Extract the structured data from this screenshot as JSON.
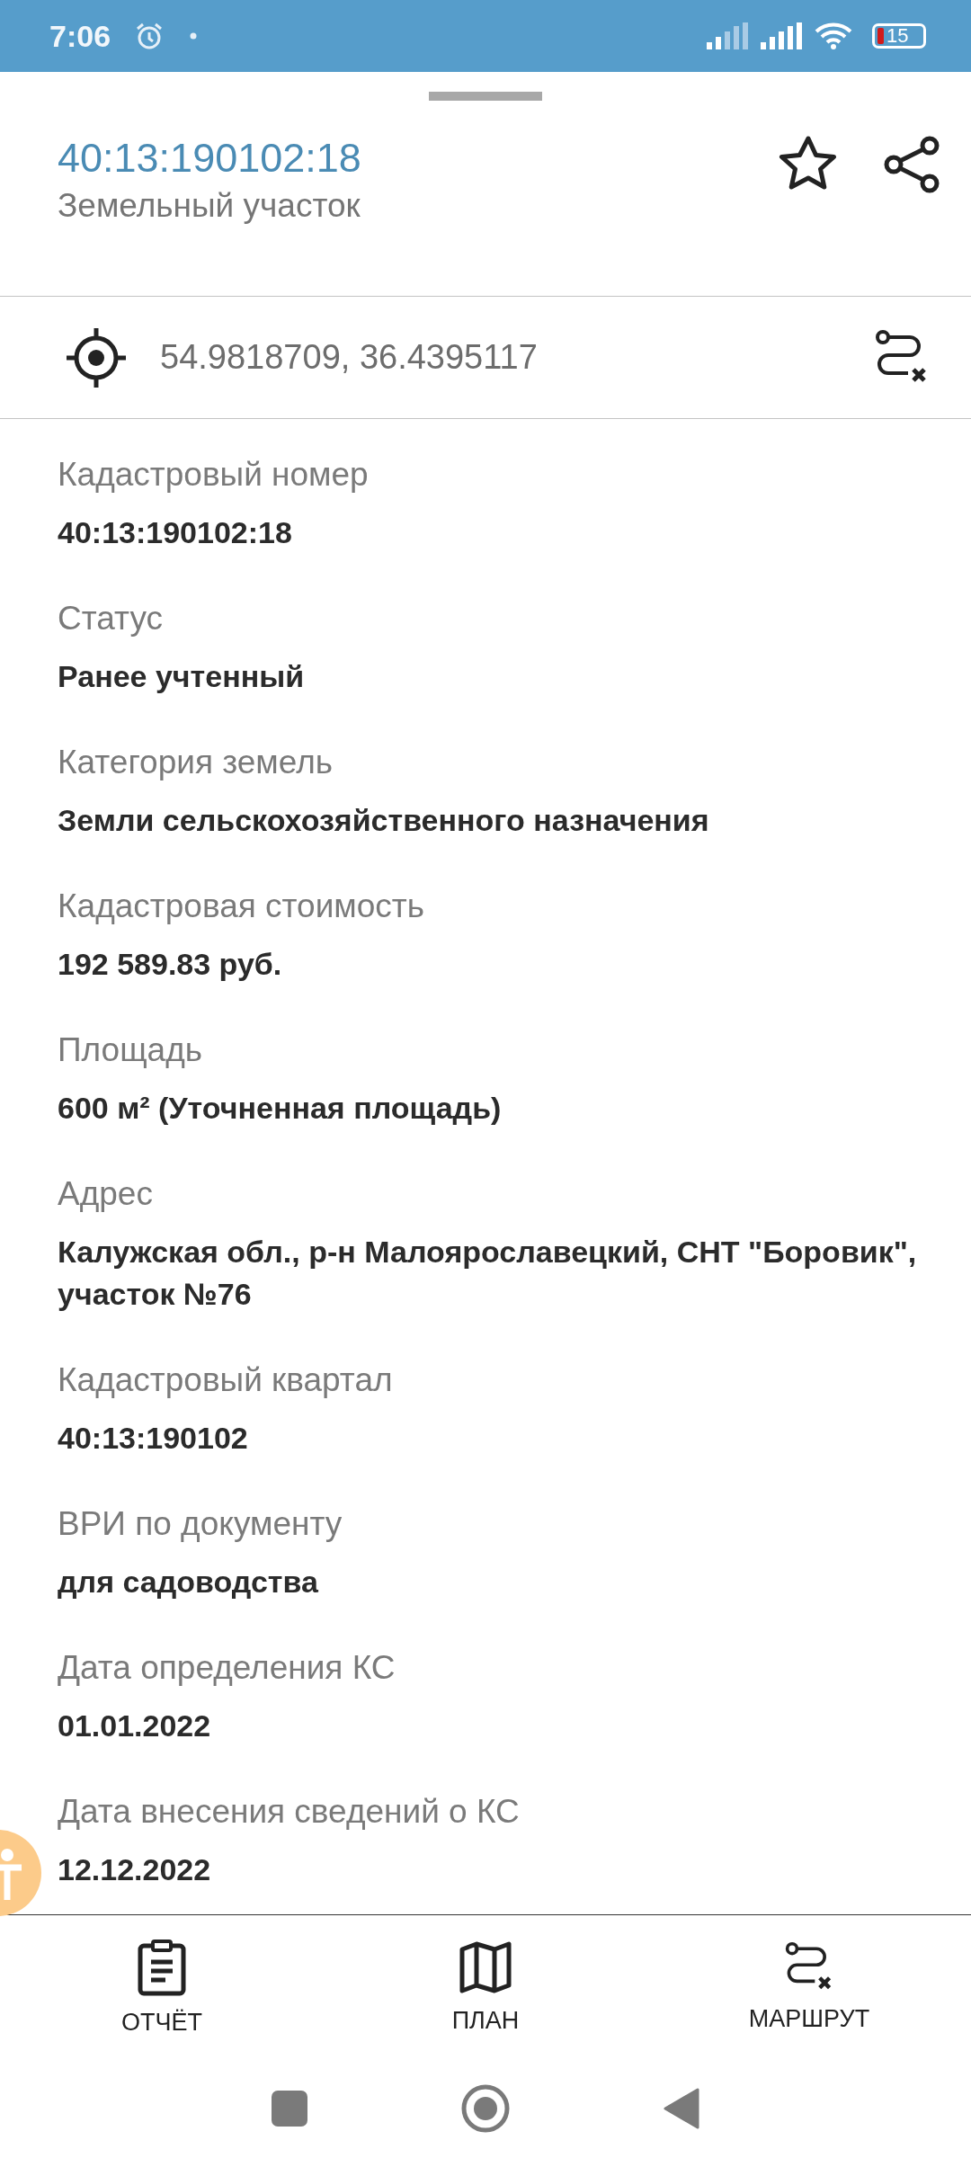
{
  "status_bar": {
    "time": "7:06",
    "battery": "15"
  },
  "header": {
    "title": "40:13:190102:18",
    "subtitle": "Земельный участок"
  },
  "coordinates": {
    "text": "54.9818709, 36.4395117"
  },
  "fields": [
    {
      "label": "Кадастровый номер",
      "value": "40:13:190102:18"
    },
    {
      "label": "Статус",
      "value": "Ранее учтенный"
    },
    {
      "label": "Категория земель",
      "value": "Земли сельскохозяйственного назначения"
    },
    {
      "label": "Кадастровая стоимость",
      "value": "192 589.83 руб."
    },
    {
      "label": "Площадь",
      "value": "600 м² (Уточненная площадь)"
    },
    {
      "label": "Адрес",
      "value": "Калужская обл., р-н Малоярославецкий, СНТ \"Боровик\",  участок №76"
    },
    {
      "label": "Кадастровый квартал",
      "value": "40:13:190102"
    },
    {
      "label": "ВРИ по документу",
      "value": "для садоводства"
    },
    {
      "label": "Дата определения КС",
      "value": "01.01.2022"
    },
    {
      "label": "Дата внесения сведений о КС",
      "value": "12.12.2022"
    }
  ],
  "bottom_nav": [
    {
      "kind": "report",
      "label": "ОТЧЁТ"
    },
    {
      "kind": "plan",
      "label": "ПЛАН"
    },
    {
      "kind": "route",
      "label": "МАРШРУТ"
    }
  ]
}
